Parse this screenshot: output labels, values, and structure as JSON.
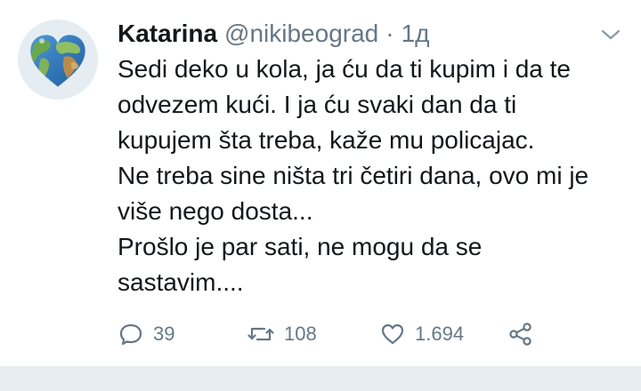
{
  "tweet": {
    "author": {
      "display_name": "Katarina",
      "handle": "@nikibeograd",
      "avatar_icon": "globe-heart-icon"
    },
    "separator": "·",
    "time": "1д",
    "menu_icon": "chevron-down-icon",
    "text_lines": [
      "Sedi deko u kola, ja ću da ti kupim i da te",
      "odvezem kući. I ja ću svaki dan da ti",
      "kupujem šta treba, kaže mu policajac.",
      "Ne treba sine ništa tri četiri dana, ovo mi je",
      "više nego dosta...",
      "Prošlo je par sati, ne mogu da se",
      "sastavim...."
    ],
    "actions": {
      "reply": {
        "icon": "reply-icon",
        "count": "39"
      },
      "retweet": {
        "icon": "retweet-icon",
        "count": "108"
      },
      "like": {
        "icon": "heart-icon",
        "count": "1.694"
      },
      "share": {
        "icon": "share-icon"
      }
    }
  },
  "colors": {
    "text_primary": "#14171a",
    "text_secondary": "#657786",
    "divider": "#e6ecf0",
    "background": "#ffffff"
  }
}
